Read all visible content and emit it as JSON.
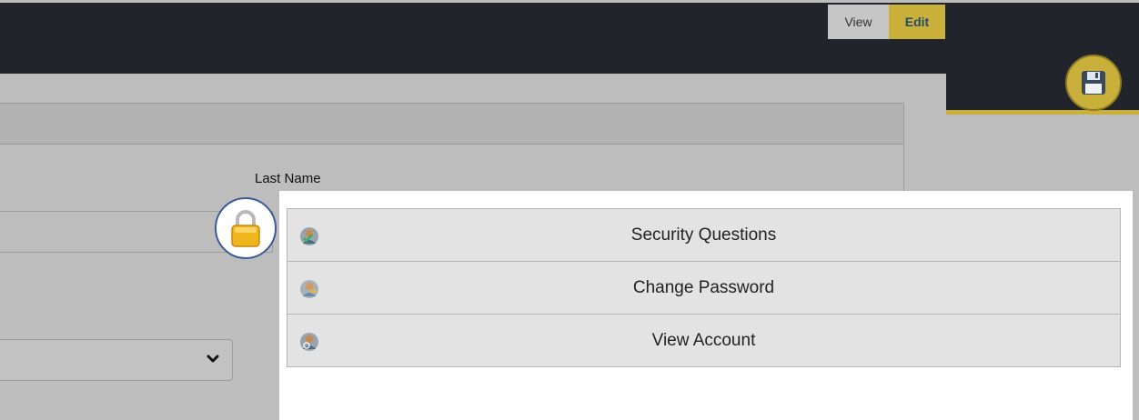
{
  "header": {
    "mode_view_label": "View",
    "mode_edit_label": "Edit"
  },
  "form": {
    "last_name_label": "Last Name"
  },
  "menu": {
    "items": [
      {
        "label": "Security Questions",
        "icon": "user-check-icon"
      },
      {
        "label": "Change Password",
        "icon": "user-key-icon"
      },
      {
        "label": "View Account",
        "icon": "user-search-icon"
      }
    ]
  },
  "icons": {
    "lock": "lock-icon",
    "save": "floppy-disk-icon",
    "select": "chevron-down-icon"
  },
  "colors": {
    "topbar": "#21252b",
    "accent": "#c8b03a",
    "background": "#bdbdbd",
    "lock_border": "#3c5a9a"
  }
}
